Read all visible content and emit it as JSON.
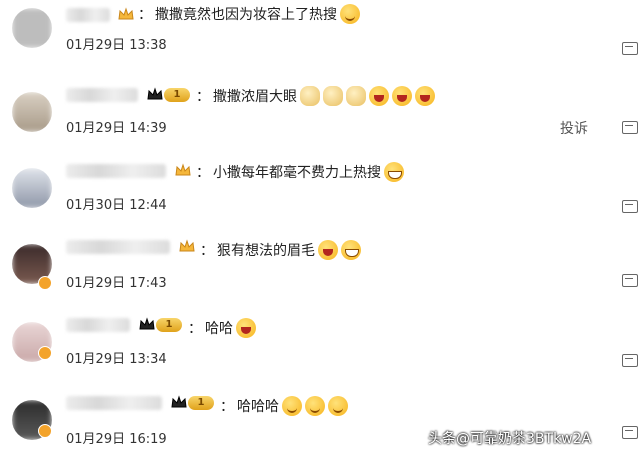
{
  "comments": [
    {
      "text": "撒撒竟然也因为妆容上了热搜",
      "date": "01月29日 13:38",
      "level": "",
      "emojis": [
        "smile"
      ]
    },
    {
      "text": "撒撒浓眉大眼",
      "date": "01月29日 14:39",
      "level": "1",
      "emojis": [
        "dog",
        "dog",
        "dog",
        "laugh",
        "laugh",
        "laugh"
      ],
      "report": "投诉"
    },
    {
      "text": "小撒每年都毫不费力上热搜",
      "date": "01月30日 12:44",
      "level": "",
      "emojis": [
        "grin"
      ]
    },
    {
      "text": "狠有想法的眉毛",
      "date": "01月29日 17:43",
      "level": "",
      "emojis": [
        "laugh",
        "grin"
      ]
    },
    {
      "text": "哈哈",
      "date": "01月29日 13:34",
      "level": "1",
      "emojis": [
        "tongue"
      ]
    },
    {
      "text": "哈哈哈",
      "date": "01月29日 16:19",
      "level": "1",
      "emojis": [
        "party",
        "party",
        "party"
      ]
    }
  ],
  "watermark": "头条@可靠奶茶3BTkw2A",
  "icons": {
    "message": "message-icon",
    "crown": "crown-icon",
    "verified": "verified-badge-icon"
  }
}
